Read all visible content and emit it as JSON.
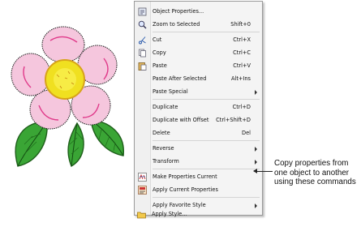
{
  "menu": {
    "items": [
      {
        "label": "Object Properties...",
        "shortcut": "",
        "icon": "object-properties-icon"
      },
      {
        "label": "Zoom to Selected",
        "shortcut": "Shift+0",
        "icon": "zoom-icon"
      },
      {
        "label": "Cut",
        "shortcut": "Ctrl+X",
        "icon": "scissors-icon"
      },
      {
        "label": "Copy",
        "shortcut": "Ctrl+C",
        "icon": "copy-icon"
      },
      {
        "label": "Paste",
        "shortcut": "Ctrl+V",
        "icon": "paste-icon"
      },
      {
        "label": "Paste After Selected",
        "shortcut": "Alt+Ins",
        "icon": ""
      },
      {
        "label": "Paste Special",
        "shortcut": "",
        "icon": "",
        "submenu": true
      },
      {
        "label": "Duplicate",
        "shortcut": "Ctrl+D",
        "icon": ""
      },
      {
        "label": "Duplicate with Offset",
        "shortcut": "Ctrl+Shift+D",
        "icon": ""
      },
      {
        "label": "Delete",
        "shortcut": "Del",
        "icon": ""
      },
      {
        "label": "Reverse",
        "shortcut": "",
        "icon": "",
        "submenu": true
      },
      {
        "label": "Transform",
        "shortcut": "",
        "icon": "",
        "submenu": true
      },
      {
        "label": "Make Properties Current",
        "shortcut": "",
        "icon": "make-properties-current-icon"
      },
      {
        "label": "Apply Current Properties",
        "shortcut": "",
        "icon": "apply-properties-icon"
      },
      {
        "label": "Apply Favorite Style",
        "shortcut": "",
        "icon": "",
        "submenu": true
      },
      {
        "label": "Apply Style...",
        "shortcut": "",
        "icon": "folder-icon"
      }
    ]
  },
  "callout": {
    "text": "Copy properties from one object to another using these commands"
  }
}
